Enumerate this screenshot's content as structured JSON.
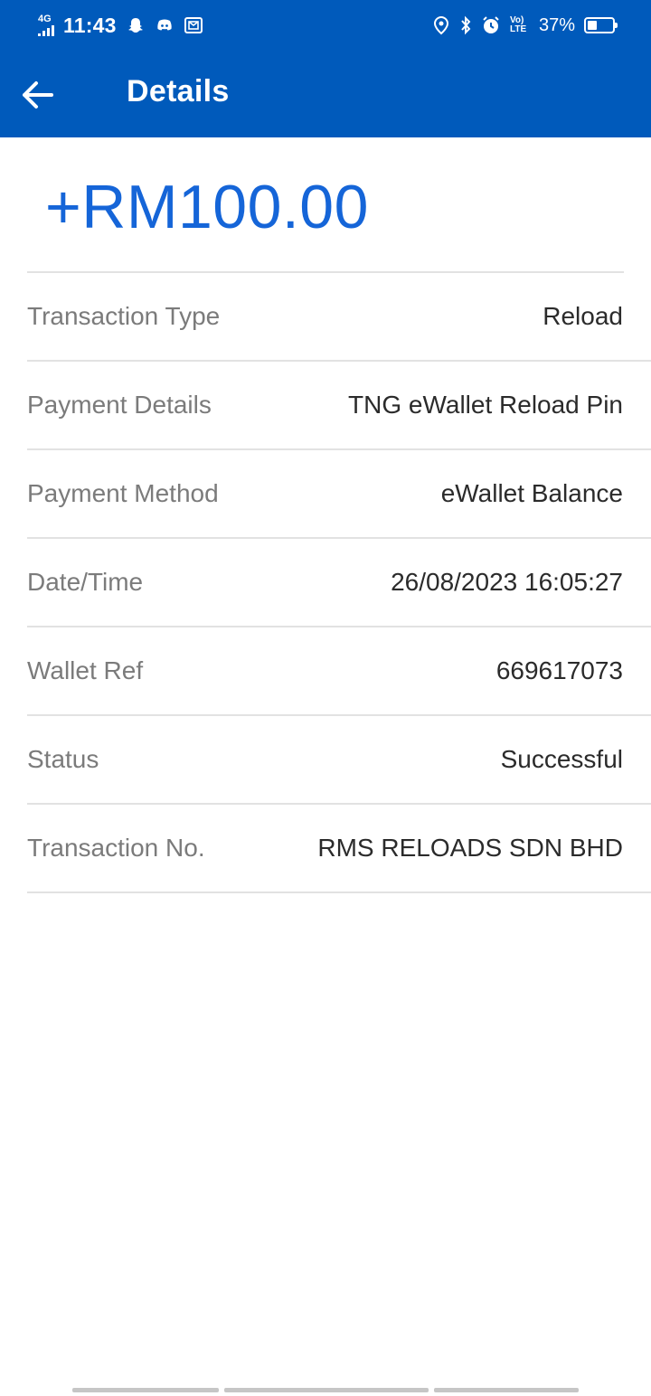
{
  "status_bar": {
    "network": "4G",
    "time": "11:43",
    "battery_percent": "37%",
    "battery_level": 0.37,
    "volte_label": "Vo) LTE",
    "left_icons": [
      "snapchat-icon",
      "discord-icon",
      "mail-icon"
    ],
    "right_icons": [
      "location-icon",
      "bluetooth-icon",
      "alarm-icon",
      "volte-icon",
      "battery-icon"
    ]
  },
  "app_bar": {
    "title": "Details",
    "back_icon": "arrow-left-icon",
    "background": "#005abb"
  },
  "amount": {
    "text": "+RM100.00",
    "color": "#1565d8"
  },
  "details": [
    {
      "label": "Transaction Type",
      "value": "Reload"
    },
    {
      "label": "Payment Details",
      "value": "TNG eWallet Reload Pin"
    },
    {
      "label": "Payment Method",
      "value": "eWallet Balance"
    },
    {
      "label": "Date/Time",
      "value": "26/08/2023 16:05:27"
    },
    {
      "label": "Wallet Ref",
      "value": "669617073"
    },
    {
      "label": "Status",
      "value": "Successful"
    },
    {
      "label": "Transaction No.",
      "value": "RMS RELOADS SDN BHD"
    }
  ]
}
